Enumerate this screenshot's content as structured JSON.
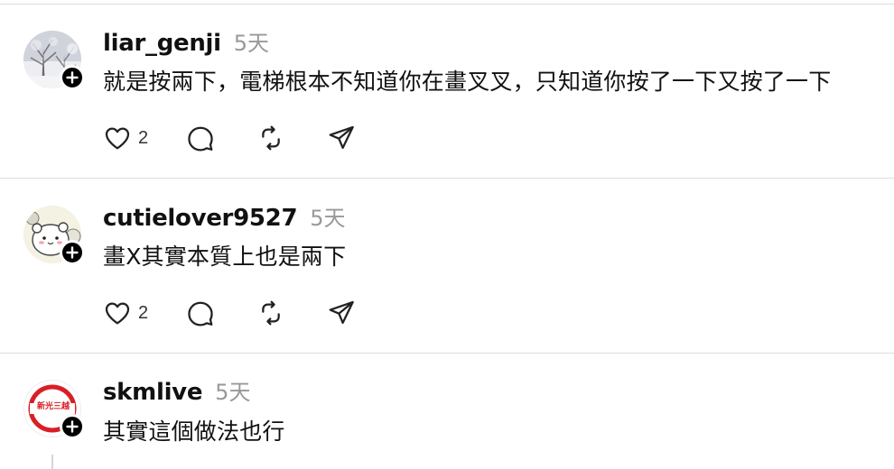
{
  "posts": [
    {
      "username": "liar_genji",
      "time": "5天",
      "text": "就是按兩下，電梯根本不知道你在畫叉叉，只知道你按了一下又按了一下",
      "like_count": "2",
      "avatar_icon": "snowy-tree-photo"
    },
    {
      "username": "cutielover9527",
      "time": "5天",
      "text": "畫X其實本質上也是兩下",
      "like_count": "2",
      "avatar_icon": "cartoon-bear-illustration"
    },
    {
      "username": "skmlive",
      "time": "5天",
      "text": "其實這個做法也行",
      "avatar_logo_text": "新光三越",
      "avatar_icon": "skm-logo"
    }
  ],
  "icons": {
    "like": "heart-icon",
    "reply": "comment-bubble-icon",
    "repost": "repost-icon",
    "share": "send-icon",
    "follow": "plus-icon"
  },
  "colors": {
    "text": "#111111",
    "muted": "#999999",
    "divider": "#dcdcdc",
    "skm_red": "#d81f26"
  }
}
